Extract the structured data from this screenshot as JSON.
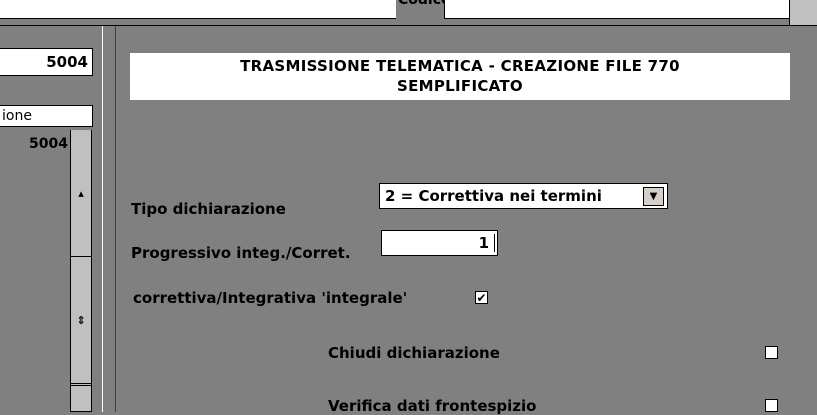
{
  "header": {
    "codice_fiscale_label": "Codice fiscale"
  },
  "left": {
    "code_value": "5004",
    "search_text": "ione",
    "list_items": [
      "5004"
    ],
    "scroll_up_glyph": "▴",
    "scroll_mid_glyph": "⇕"
  },
  "main": {
    "title_line1": "TRASMISSIONE TELEMATICA - CREAZIONE FILE 770",
    "title_line2": "SEMPLIFICATO",
    "tipo_label": "Tipo dichiarazione",
    "tipo_value": "2 = Correttiva nei termini",
    "prog_label": "Progressivo integ./Corret.",
    "prog_value": "1",
    "corr_label": "correttiva/Integrativa 'integrale'",
    "corr_checked": true,
    "chiudi_label": "Chiudi dichiarazione",
    "chiudi_checked": false,
    "verifica_label": "Verifica dati frontespizio",
    "verifica_checked": false
  },
  "colors": {
    "background": "#808080",
    "field": "#ffffff",
    "control": "#c0c0c0"
  }
}
